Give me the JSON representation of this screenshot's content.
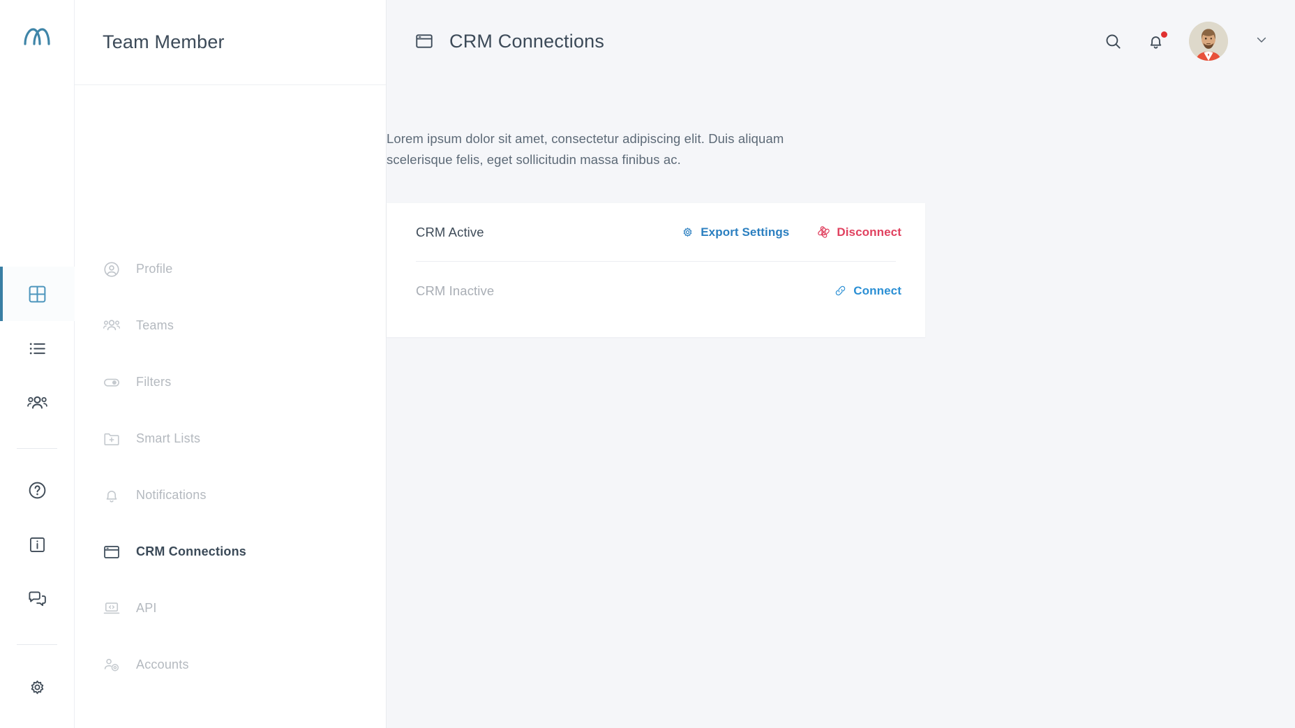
{
  "brand": {
    "logo_icon": "meta-arch-logo",
    "logo_color": "#3f85a8"
  },
  "rail": {
    "items": [
      {
        "id": "dashboard",
        "icon": "grid-dashboard-icon",
        "active": true
      },
      {
        "id": "lists",
        "icon": "bullet-list-icon",
        "active": false
      },
      {
        "id": "people",
        "icon": "people-group-icon",
        "active": false
      },
      {
        "id": "help",
        "icon": "question-circle-icon",
        "active": false
      },
      {
        "id": "info",
        "icon": "info-box-icon",
        "active": false
      },
      {
        "id": "messages",
        "icon": "chat-bubbles-icon",
        "active": false
      },
      {
        "id": "settings",
        "icon": "gear-icon",
        "active": false
      }
    ]
  },
  "sidebar": {
    "title": "Team Member",
    "items": [
      {
        "label": "Profile",
        "icon": "user-circle-icon",
        "active": false
      },
      {
        "label": "Teams",
        "icon": "people-group-icon",
        "active": false
      },
      {
        "label": "Filters",
        "icon": "toggle-switch-icon",
        "active": false
      },
      {
        "label": "Smart Lists",
        "icon": "folder-plus-icon",
        "active": false
      },
      {
        "label": "Notifications",
        "icon": "bell-icon",
        "active": false
      },
      {
        "label": "CRM Connections",
        "icon": "window-icon",
        "active": true
      },
      {
        "label": "API",
        "icon": "laptop-code-icon",
        "active": false
      },
      {
        "label": "Accounts",
        "icon": "user-gear-icon",
        "active": false
      }
    ]
  },
  "header": {
    "title": "CRM Connections",
    "title_icon": "window-icon",
    "search_icon": "search-icon",
    "notifications_icon": "bell-icon",
    "has_notification_dot": true,
    "avatar_icon": "user-avatar",
    "chevron_icon": "chevron-down-icon"
  },
  "main": {
    "description": "Lorem ipsum dolor sit amet, consectetur adipiscing elit. Duis aliquam scelerisque felis, eget sollicitudin massa finibus ac.",
    "connections": [
      {
        "name": "CRM Active",
        "state": "active",
        "actions": [
          {
            "label": "Export Settings",
            "icon": "gear-icon",
            "style": "blue"
          },
          {
            "label": "Disconnect",
            "icon": "unlink-icon",
            "style": "red"
          }
        ]
      },
      {
        "name": "CRM Inactive",
        "state": "inactive",
        "actions": [
          {
            "label": "Connect",
            "icon": "link-icon",
            "style": "blue-light"
          }
        ]
      }
    ]
  },
  "colors": {
    "background": "#f5f6f9",
    "surface": "#ffffff",
    "accent_blue": "#2b7fc0",
    "accent_red": "#e0415f",
    "rail_active": "#3a7fa4",
    "text_primary": "#3c4a58",
    "text_muted": "#a9aeb5"
  }
}
